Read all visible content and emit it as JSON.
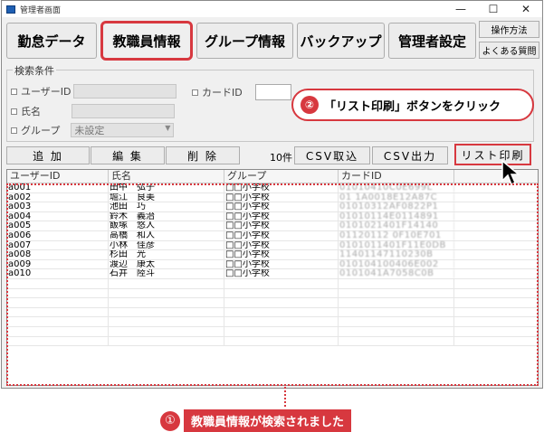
{
  "window": {
    "title": "管理者画面",
    "controls": [
      "—",
      "☐",
      "✕"
    ]
  },
  "tabs": [
    "勤怠データ",
    "教職員情報",
    "グループ情報",
    "バックアップ",
    "管理者設定"
  ],
  "side_buttons": [
    "操作方法",
    "よくある質問"
  ],
  "search": {
    "legend": "検索条件",
    "user_id_label": "ユーザーID",
    "card_id_label": "カードID",
    "name_label": "氏名",
    "group_label": "グループ",
    "group_value": "未設定"
  },
  "actions": {
    "add": "追 加",
    "edit": "編 集",
    "delete": "削 除",
    "count": "10件",
    "csv_import": "CSV取込",
    "csv_export": "CSV出力",
    "print_list": "リスト印刷"
  },
  "table": {
    "headers": [
      "ユーザーID",
      "氏名",
      "グループ",
      "カードID"
    ],
    "rows": [
      [
        "a001",
        "田中　弘子",
        "□□小学校",
        "01010410C0E699L"
      ],
      [
        "a002",
        "堀江　良美",
        "□□小学校",
        "01 1A0018E12A87C"
      ],
      [
        "a003",
        "池田　巧",
        "□□小学校",
        "01010312AF0822P1"
      ],
      [
        "a004",
        "鈴木　義治",
        "□□小学校",
        "01010114E0114891"
      ],
      [
        "a005",
        "飯塚　悠人",
        "□□小学校",
        "0101021401F14140"
      ],
      [
        "a006",
        "高橋　和人",
        "□□小学校",
        "01120112 0F10E701"
      ],
      [
        "a007",
        "小林　佳彦",
        "□□小学校",
        "0101011401F11E0DB"
      ],
      [
        "a008",
        "杉田　光",
        "□□小学校",
        "11401147110230B"
      ],
      [
        "a009",
        "渡辺　康太",
        "□□小学校",
        "010104100406E002"
      ],
      [
        "a010",
        "石井　陸斗",
        "□□小学校",
        "0101041A7058C0B"
      ]
    ]
  },
  "annotations": {
    "step2_number": "②",
    "step2_text": "「リスト印刷」ボタンをクリック",
    "step1_number": "①",
    "step1_text": "教職員情報が検索されました"
  },
  "colors": {
    "accent": "#d7383f"
  }
}
